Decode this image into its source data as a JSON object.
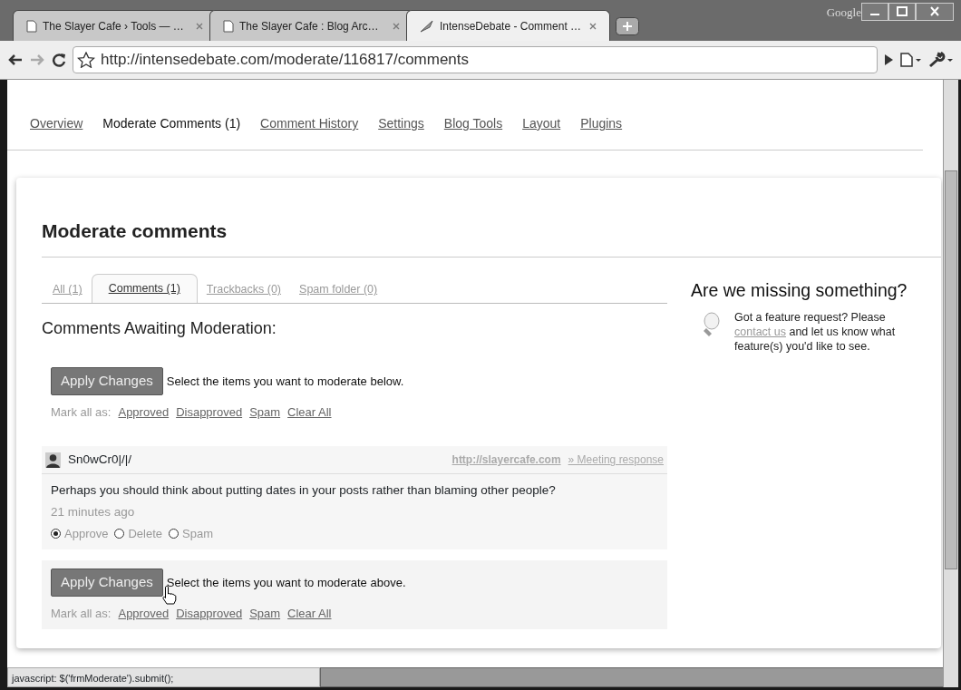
{
  "browser": {
    "brand": "Google",
    "tabs": [
      {
        "title": "The Slayer Cafe › Tools — …",
        "selected": false,
        "kind": "page"
      },
      {
        "title": "The Slayer Cafe : Blog Arc…",
        "selected": false,
        "kind": "page"
      },
      {
        "title": "IntenseDebate - Comment …",
        "selected": true,
        "kind": "quill"
      }
    ],
    "url": "http://intensedebate.com/moderate/116817/comments"
  },
  "nav": [
    {
      "label": "Overview",
      "selected": false
    },
    {
      "label": "Moderate Comments (1)",
      "selected": true
    },
    {
      "label": "Comment History",
      "selected": false
    },
    {
      "label": "Settings",
      "selected": false
    },
    {
      "label": "Blog Tools",
      "selected": false
    },
    {
      "label": "Layout",
      "selected": false
    },
    {
      "label": "Plugins",
      "selected": false
    }
  ],
  "title": "Moderate comments",
  "filters": [
    {
      "label": "All (1)",
      "selected": false
    },
    {
      "label": "Comments (1)",
      "selected": true
    },
    {
      "label": "Trackbacks (0)",
      "selected": false
    },
    {
      "label": "Spam folder (0)",
      "selected": false
    }
  ],
  "heading": "Comments Awaiting Moderation:",
  "top_bar": {
    "button": "Apply Changes",
    "hint": "Select the items you want to moderate below.",
    "mark_label": "Mark all as:",
    "mark_links": [
      "Approved",
      "Disapproved",
      "Spam",
      "Clear All"
    ]
  },
  "comments": [
    {
      "author": "Sn0wCr0|/|/",
      "site": "http://slayercafe.com",
      "post": "» Meeting response",
      "text": "Perhaps you should think about putting dates in your posts rather than blaming other people?",
      "time": "21 minutes ago",
      "actions": [
        {
          "label": "Approve",
          "selected": true
        },
        {
          "label": "Delete",
          "selected": false
        },
        {
          "label": "Spam",
          "selected": false
        }
      ]
    }
  ],
  "bottom_bar": {
    "button": "Apply Changes",
    "hint": "Select the items you want to moderate above.",
    "mark_label": "Mark all as:",
    "mark_links": [
      "Approved",
      "Disapproved",
      "Spam",
      "Clear All"
    ]
  },
  "sidebar": {
    "heading": "Are we missing something?",
    "text_before": "Got a feature request? Please",
    "link": "contact us",
    "text_after": "and let us know what feature(s) you'd like to see."
  },
  "status_bar": "javascript: $('frmModerate').submit();"
}
